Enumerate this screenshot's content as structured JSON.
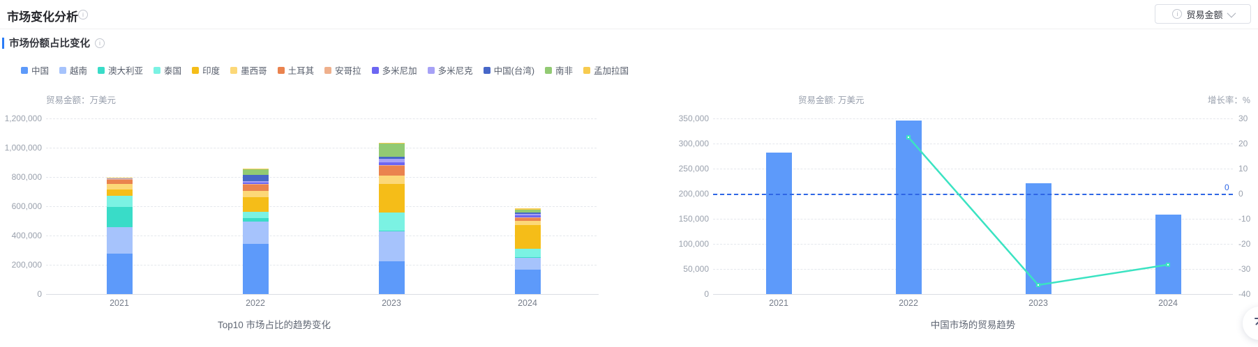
{
  "page": {
    "title": "市场变化分析",
    "section_title": "市场份额占比变化",
    "metric_selector": {
      "label": "贸易金额",
      "info_icon": "i",
      "chevron_icon": "chevron-down"
    }
  },
  "icons": {
    "info": "i",
    "back_to_top": "arrow-up-to-line"
  },
  "chart_data": [
    {
      "type": "bar",
      "stacked": true,
      "title": "Top10 市场占比的趋势变化",
      "unit_label": "贸易金额：万美元",
      "categories": [
        "2021",
        "2022",
        "2023",
        "2024"
      ],
      "ylabel": "贸易金额(万美元)",
      "ylim": [
        0,
        1200000
      ],
      "ytick_step": 200000,
      "grid": true,
      "legend_position": "top",
      "series": [
        {
          "name": "中国",
          "color": "#5d9afa",
          "values": [
            278000,
            342000,
            224000,
            166000
          ]
        },
        {
          "name": "越南",
          "color": "#a6c3fc",
          "values": [
            181000,
            153000,
            203000,
            85000
          ]
        },
        {
          "name": "澳大利亚",
          "color": "#39dcc8",
          "values": [
            136000,
            24000,
            8000,
            3000
          ]
        },
        {
          "name": "泰国",
          "color": "#7bf2e3",
          "values": [
            77000,
            43000,
            120000,
            56000
          ]
        },
        {
          "name": "印度",
          "color": "#f5bd18",
          "values": [
            43000,
            99000,
            197000,
            163000
          ]
        },
        {
          "name": "墨西哥",
          "color": "#fcd878",
          "values": [
            37000,
            42000,
            56000,
            29000
          ]
        },
        {
          "name": "土耳其",
          "color": "#ea834e",
          "values": [
            27000,
            46000,
            72000,
            21000
          ]
        },
        {
          "name": "安哥拉",
          "color": "#efb08c",
          "values": [
            5000,
            2000,
            3000,
            3000
          ]
        },
        {
          "name": "多米尼加",
          "color": "#6c66f2",
          "values": [
            5000,
            11000,
            19000,
            10000
          ]
        },
        {
          "name": "多米尼克",
          "color": "#a6a1f6",
          "values": [
            3000,
            10000,
            21000,
            10000
          ]
        },
        {
          "name": "中国(台湾)",
          "color": "#4767c8",
          "values": [
            2000,
            40000,
            13000,
            9000
          ]
        },
        {
          "name": "南非",
          "color": "#92ca73",
          "values": [
            2000,
            43000,
            94000,
            19000
          ]
        },
        {
          "name": "孟加拉国",
          "color": "#f7cb4f",
          "values": [
            1000,
            1000,
            2000,
            11000
          ]
        }
      ]
    },
    {
      "type": "bar+line",
      "title": "中国市场的贸易趋势",
      "left_unit_label": "贸易金额: 万美元",
      "right_unit_label": "增长率：%",
      "categories": [
        "2021",
        "2022",
        "2023",
        "2024"
      ],
      "left_ylim": [
        0,
        350000
      ],
      "left_tick_step": 50000,
      "right_ylim": [
        -40,
        30
      ],
      "right_tick_step": 10,
      "grid": true,
      "bar_series": {
        "name": "贸易金额",
        "color": "#5d9afa",
        "values": [
          282000,
          346000,
          221000,
          159000
        ]
      },
      "line_series": {
        "name": "增长率",
        "color": "#3be3c2",
        "values": [
          null,
          22.5,
          -36.4,
          -28.3
        ]
      },
      "markline": {
        "value": 0,
        "label": "0",
        "color": "#2e66e5",
        "style": "dashed"
      }
    }
  ]
}
